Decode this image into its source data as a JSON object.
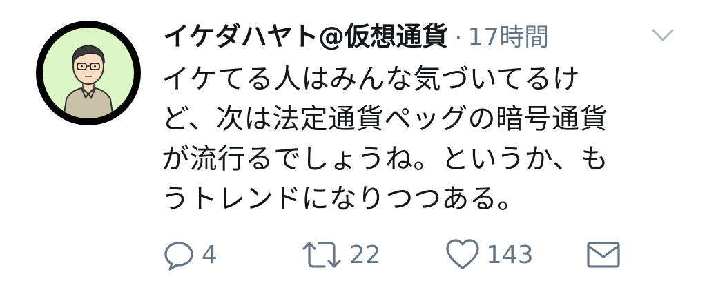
{
  "tweet": {
    "display_name": "イケダハヤト@仮想通貨",
    "separator": "·",
    "timestamp": "17時間",
    "text": "イケてる人はみんな気づいてるけ\nど、次は法定通貨ペッグの暗号通貨\nが流行るでしょうね。というか、も\nうトレンドになりつつある。"
  },
  "actions": {
    "reply": {
      "icon": "reply-icon",
      "count": "4"
    },
    "retweet": {
      "icon": "retweet-icon",
      "count": "22"
    },
    "like": {
      "icon": "heart-icon",
      "count": "143"
    },
    "dm": {
      "icon": "envelope-icon"
    }
  },
  "colors": {
    "text": "#14171a",
    "secondary": "#657786",
    "avatar_bg": "#dcf5c4",
    "avatar_ring": "#000000"
  }
}
